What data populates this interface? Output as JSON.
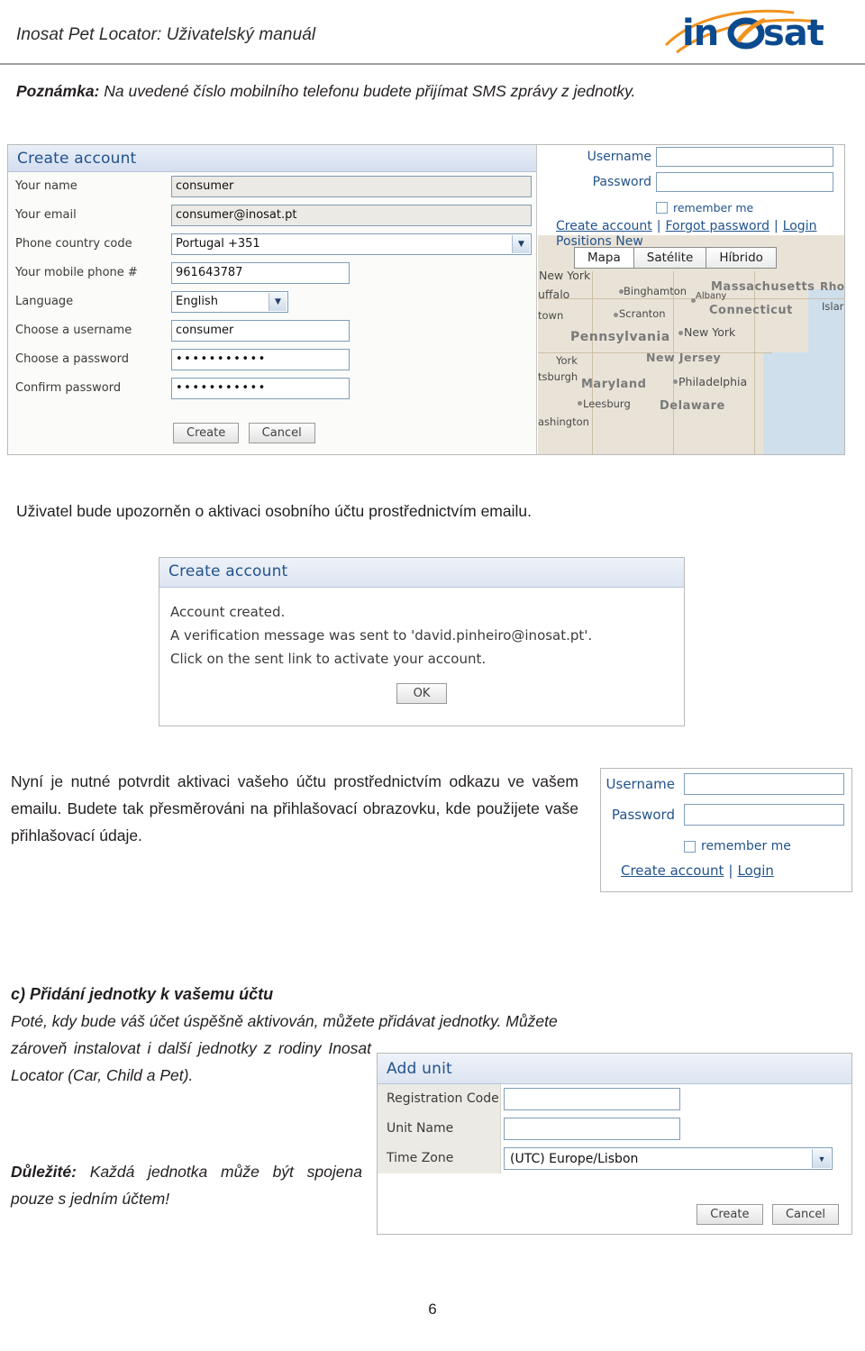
{
  "header": {
    "title": "Inosat Pet Locator: Uživatelský manuál",
    "logo_text": "inosat"
  },
  "note": {
    "label": "Poznámka:",
    "text": " Na uvedené číslo mobilního telefonu budete přijímat SMS zprávy z jednotky."
  },
  "screenshot_create_account": {
    "window_title": "Create account",
    "fields": [
      {
        "label": "Your name",
        "value": "consumer",
        "type": "text"
      },
      {
        "label": "Your email",
        "value": "consumer@inosat.pt",
        "type": "text"
      },
      {
        "label": "Phone country code",
        "value": "Portugal +351",
        "type": "select"
      },
      {
        "label": "Your mobile phone #",
        "value": "961643787",
        "type": "text"
      },
      {
        "label": "Language",
        "value": "English",
        "type": "select"
      },
      {
        "label": "Choose a username",
        "value": "consumer",
        "type": "text"
      },
      {
        "label": "Choose a password",
        "value": "•••••••••••",
        "type": "password"
      },
      {
        "label": "Confirm password",
        "value": "•••••••••••",
        "type": "password"
      }
    ],
    "create_button": "Create",
    "cancel_button": "Cancel",
    "login_panel": {
      "username_label": "Username",
      "password_label": "Password",
      "remember_label": "remember me",
      "create_account_link": "Create account",
      "forgot_password_link": "Forgot password",
      "login_link": "Login",
      "obscured_row": "Positions                    New"
    },
    "map": {
      "tabs": [
        "Mapa",
        "Satélite",
        "Híbrido"
      ],
      "active_tab": "Mapa",
      "labels": [
        "uffalo",
        "Binghamton",
        "Massachusetts",
        "Rho",
        "Islar",
        "town",
        "Scranton",
        "Connecticut",
        "Albany",
        "Pennsylvania",
        "New York",
        "York",
        "New Jersey",
        "tsburgh",
        "Maryland",
        "Philadelphia",
        "Leesburg",
        "Delaware",
        "ashington",
        "New York"
      ]
    }
  },
  "para_activate": "Uživatel bude upozorněn o aktivaci osobního účtu prostřednictvím emailu.",
  "screenshot_account_created": {
    "window_title": "Create account",
    "line1": "Account created.",
    "line2": "A verification message was sent to 'david.pinheiro@inosat.pt'.",
    "line3": "Click on the sent link to activate your account.",
    "ok_button": "OK"
  },
  "para_redirect": "Nyní je nutné potvrdit aktivaci vašeho účtu prostřednictvím odkazu ve vašem emailu. Budete tak přesměrováni na přihlašovací obrazovku, kde použijete vaše přihlašovací údaje.",
  "screenshot_login": {
    "username_label": "Username",
    "password_label": "Password",
    "remember_label": "remember me",
    "create_account_link": "Create account",
    "login_link": "Login"
  },
  "section_c": {
    "heading": "c) Přidání jednotky k vašemu účtu",
    "body_line1": "Poté, kdy bude váš účet úspěšně aktivován, můžete přidávat jednotky. Můžete",
    "body_rest": "zároveň instalovat i další jednotky z rodiny Inosat Locator (Car, Child a Pet).",
    "important_label": "Důležité:",
    "important_text": " Každá jednotka může být spojena pouze s jedním účtem!"
  },
  "screenshot_add_unit": {
    "window_title": "Add unit",
    "rows": [
      {
        "label": "Registration Code",
        "value": "",
        "type": "text"
      },
      {
        "label": "Unit Name",
        "value": "",
        "type": "text"
      },
      {
        "label": "Time Zone",
        "value": "(UTC) Europe/Lisbon",
        "type": "select"
      }
    ],
    "create_button": "Create",
    "cancel_button": "Cancel"
  },
  "page_number": "6"
}
